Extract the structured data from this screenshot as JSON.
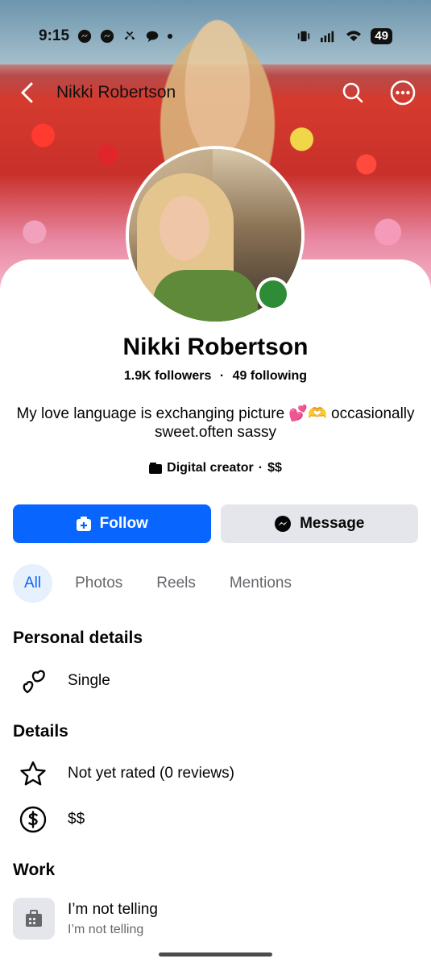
{
  "status_bar": {
    "time": "9:15",
    "battery": "49"
  },
  "nav": {
    "title": "Nikki Robertson"
  },
  "profile": {
    "name": "Nikki Robertson",
    "followers": "1.9K followers",
    "following": "49 following",
    "separator": "·",
    "bio_line1": "My love language is exchanging picture 💕🫶 occasionally",
    "bio_line2": "sweet.often sassy",
    "category": "Digital creator",
    "price": "$$"
  },
  "actions": {
    "follow_label": "Follow",
    "message_label": "Message"
  },
  "tabs": [
    {
      "label": "All",
      "active": true
    },
    {
      "label": "Photos"
    },
    {
      "label": "Reels"
    },
    {
      "label": "Mentions"
    }
  ],
  "sections": {
    "personal": {
      "title": "Personal details",
      "relationship": "Single"
    },
    "details": {
      "title": "Details",
      "rating": "Not yet rated (0 reviews)",
      "price": "$$"
    },
    "work": {
      "title": "Work",
      "workplace": "I’m not  telling",
      "workplace_sub": "I’m not telling"
    }
  },
  "colors": {
    "accent": "#0866ff",
    "online": "#2e8b36",
    "button_gray": "#e4e6eb",
    "text_secondary": "#65676b"
  }
}
